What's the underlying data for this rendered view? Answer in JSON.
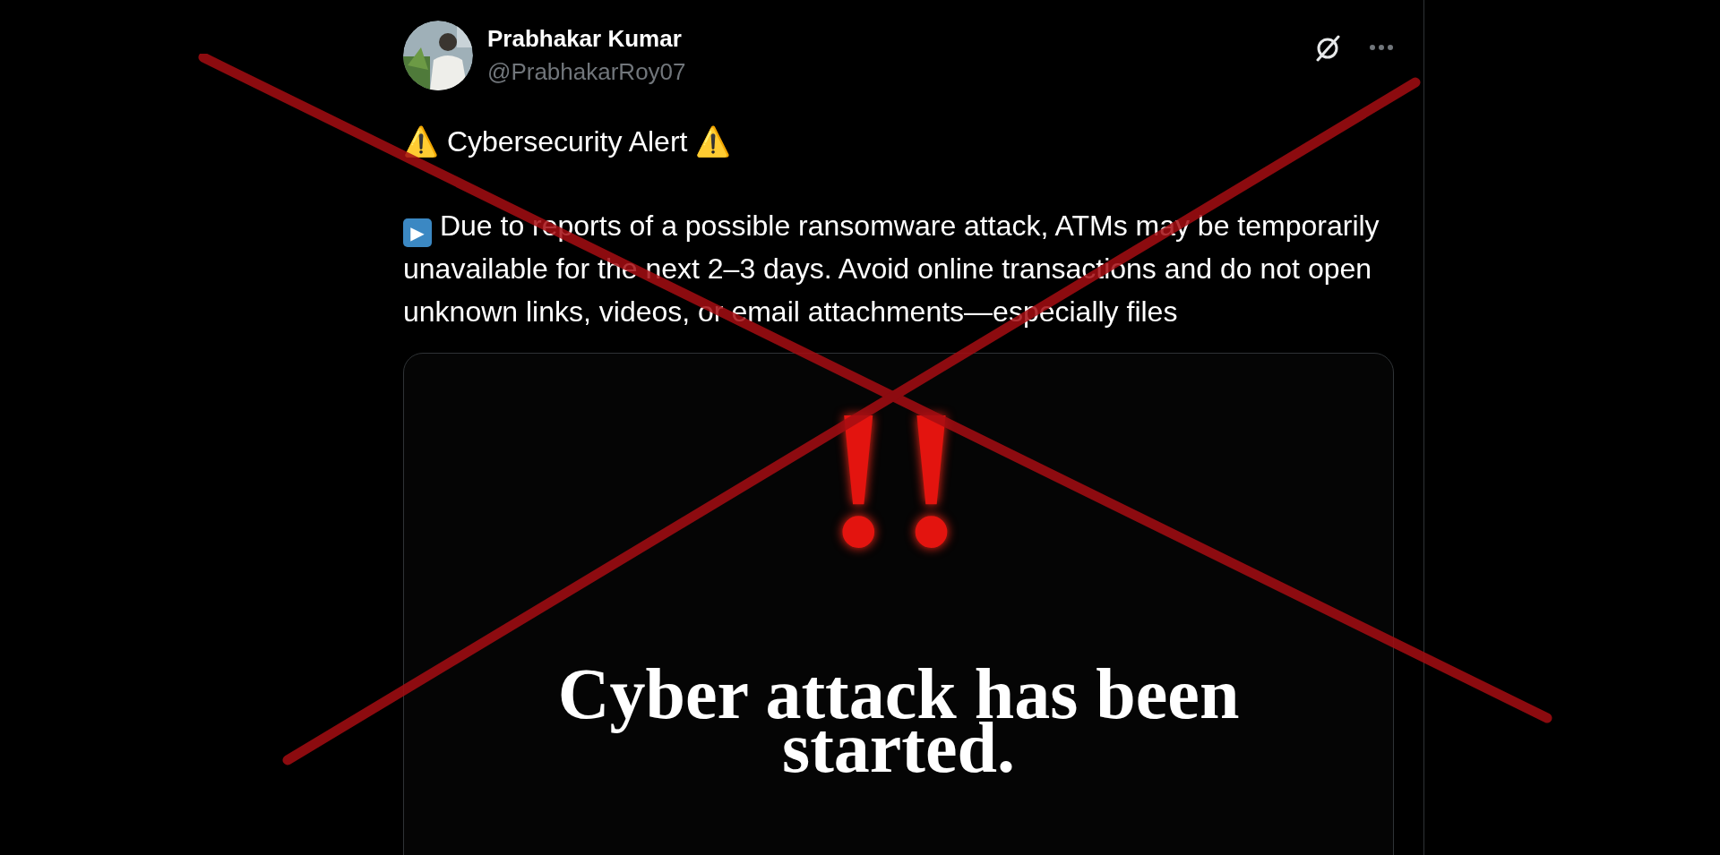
{
  "post": {
    "author": {
      "name": "Prabhakar Kumar",
      "handle": "@PrabhakarRoy07"
    },
    "title": {
      "lead": "⚠️",
      "text": "Cybersecurity Alert",
      "trail": "⚠️"
    },
    "body": {
      "bullet": "▶",
      "text": "Due to reports of a possible ransomware attack, ATMs may be temporarily unavailable for the next 2–3 days. Avoid online transactions and do not open unknown links, videos, or email attachments—especially files"
    },
    "image": {
      "mark": "!!",
      "caption": "Cyber attack has been started."
    }
  }
}
